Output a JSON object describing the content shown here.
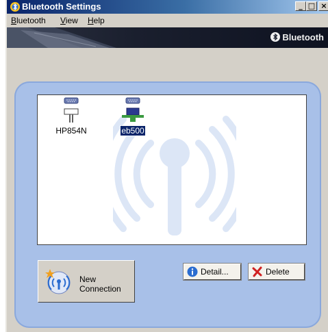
{
  "window": {
    "title": "Bluetooth Settings",
    "controls": {
      "minimize": "_",
      "maximize": "□",
      "close": "×"
    }
  },
  "menu": [
    {
      "label": "Bluetooth",
      "access_key": "B"
    },
    {
      "label": "View",
      "access_key": "V"
    },
    {
      "label": "Help",
      "access_key": "H"
    }
  ],
  "banner": {
    "logo_text": "Bluetooth"
  },
  "devices": [
    {
      "label": "HP854N",
      "icon": "printer-device-icon",
      "selected": false
    },
    {
      "label": "eb500",
      "icon": "serial-port-connected-icon",
      "selected": true
    }
  ],
  "buttons": {
    "new_connection_line1": "New",
    "new_connection_line2": "Connection",
    "detail": "Detail...",
    "delete": "Delete"
  },
  "colors": {
    "titlebar_start": "#0a246a",
    "titlebar_end": "#a6caf0",
    "panel_blue": "#a8c0e8",
    "selection": "#0a246a",
    "delete_red": "#d02020",
    "info_blue": "#2a6cd0"
  }
}
